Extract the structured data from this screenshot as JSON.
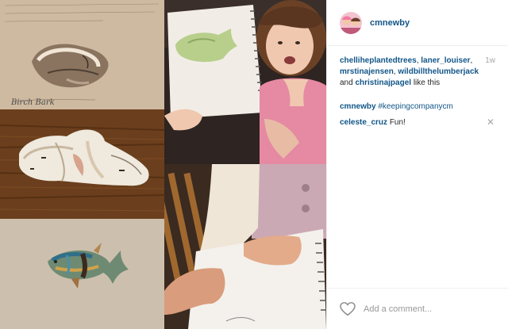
{
  "post": {
    "username": "cmnewby",
    "age": "1w",
    "likers": [
      "chelliheplantedtrees",
      "laner_louiser",
      "mrstinajensen",
      "wildbillthelumberjack"
    ],
    "likers_last": "christinajpagel",
    "likes_and": "and",
    "likes_suffix": "like this",
    "caption_user": "cmnewby",
    "caption_text": "#keepingcompanycm",
    "comments": [
      {
        "user": "celeste_cruz",
        "text": "Fun!"
      }
    ],
    "comment_placeholder": "Add a comment...",
    "sketch_caption": "Birch Bark"
  },
  "colors": {
    "link": "#125688",
    "muted": "#a5a7aa",
    "border": "#efefef"
  },
  "icons": {
    "like": "heart-outline-icon",
    "remove_comment": "close-icon"
  }
}
